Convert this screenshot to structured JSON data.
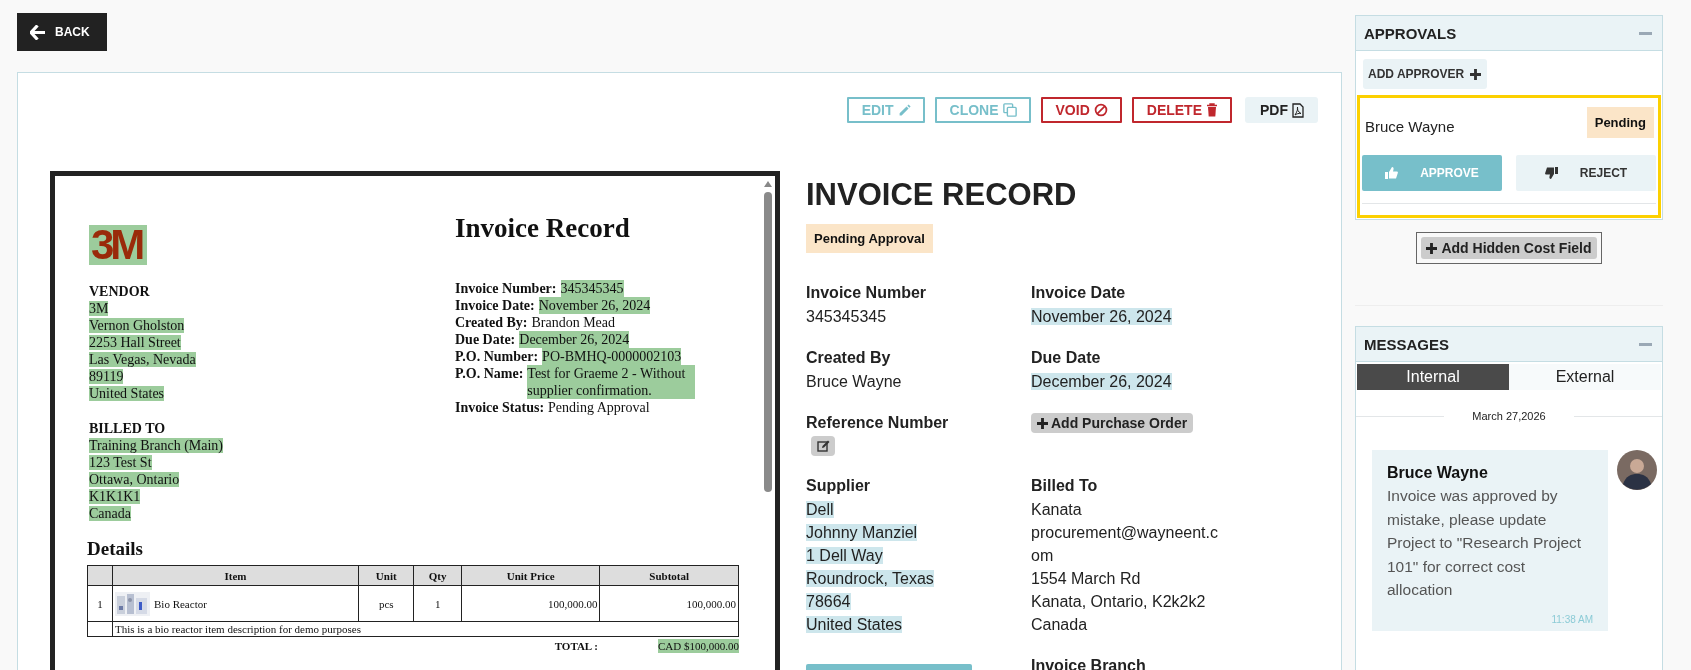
{
  "back_button": "BACK",
  "toolbar": [
    {
      "label": "EDIT",
      "kind": "edit"
    },
    {
      "label": "CLONE",
      "kind": "clone"
    },
    {
      "label": "VOID",
      "kind": "void"
    },
    {
      "label": "DELETE",
      "kind": "delete"
    },
    {
      "label": "PDF",
      "kind": "pdf"
    }
  ],
  "document": {
    "logo": "3M",
    "title": "Invoice Record",
    "vendor": {
      "heading": "VENDOR",
      "lines": [
        {
          "text": "3M",
          "highlighted": true
        },
        {
          "text": "Vernon Gholston",
          "highlighted": true
        },
        {
          "text": "2253 Hall Street",
          "highlighted": true
        },
        {
          "text": "Las Vegas, Nevada",
          "highlighted": true
        },
        {
          "text": "89119",
          "highlighted": true
        },
        {
          "text": "United States",
          "highlighted": true
        }
      ]
    },
    "fields": [
      {
        "label": "Invoice Number:",
        "value": "345345345",
        "highlighted": true
      },
      {
        "label": "Invoice Date:",
        "value": "November 26, 2024",
        "highlighted": true
      },
      {
        "label": "Created By:",
        "value": "Brandon Mead",
        "highlighted": false
      },
      {
        "label": "Due Date:",
        "value": "December 26, 2024",
        "highlighted": true
      },
      {
        "label": "P.O. Number:",
        "value": "PO-BMHQ-0000002103",
        "highlighted": true
      },
      {
        "label": "P.O. Name:",
        "value": "Test for Graeme 2 - Without supplier confirmation.",
        "highlighted": true
      },
      {
        "label": "Invoice Status:",
        "value": "Pending Approval",
        "highlighted": false
      }
    ],
    "billed_to": {
      "heading": "BILLED TO",
      "lines": [
        {
          "text": "Training Branch (Main)",
          "highlighted": true
        },
        {
          "text": "123 Test St",
          "highlighted": true
        },
        {
          "text": "Ottawa, Ontario",
          "highlighted": true
        },
        {
          "text": "K1K1K1",
          "highlighted": true
        },
        {
          "text": "Canada",
          "highlighted": true
        }
      ]
    },
    "details_heading": "Details",
    "table": {
      "columns": [
        "Item",
        "Unit",
        "Qty",
        "Unit Price",
        "Subtotal"
      ],
      "rows": [
        {
          "number": "1",
          "item": "Bio Reactor",
          "unit": "pcs",
          "qty": "1",
          "unit_price": "100,000.00",
          "subtotal": "100,000.00",
          "description": "This is a bio reactor item description for demo purposes"
        }
      ]
    },
    "total": {
      "label": "TOTAL :",
      "value": "CAD $100,000.00",
      "highlighted": true
    }
  },
  "record": {
    "title": "INVOICE RECORD",
    "status": "Pending Approval",
    "items": [
      {
        "kind": "text",
        "label": "Invoice Number",
        "lines": [
          {
            "text": "345345345",
            "highlighted": false
          }
        ]
      },
      {
        "kind": "text",
        "label": "Invoice Date",
        "lines": [
          {
            "text": "November 26, 2024",
            "highlighted": true
          }
        ]
      },
      {
        "kind": "text",
        "label": "Created By",
        "lines": [
          {
            "text": "Bruce Wayne",
            "highlighted": false
          }
        ]
      },
      {
        "kind": "text",
        "label": "Due Date",
        "lines": [
          {
            "text": "December 26, 2024",
            "highlighted": true
          }
        ]
      },
      {
        "kind": "reference",
        "label": "Reference Number"
      },
      {
        "kind": "button",
        "label": "Add Purchase Order"
      },
      {
        "kind": "text",
        "label": "Supplier",
        "lines": [
          {
            "text": "Dell",
            "highlighted": true
          },
          {
            "text": "Johnny Manziel",
            "highlighted": true
          },
          {
            "text": "1 Dell Way",
            "highlighted": true
          },
          {
            "text": "Roundrock, Texas",
            "highlighted": true
          },
          {
            "text": "78664",
            "highlighted": true
          },
          {
            "text": "United States",
            "highlighted": true
          }
        ]
      },
      {
        "kind": "text",
        "label": "Billed To",
        "lines": [
          {
            "text": "Kanata",
            "highlighted": false
          },
          {
            "text": "procurement@wayneent.com",
            "highlighted": false
          },
          {
            "text": "1554 March Rd",
            "highlighted": false
          },
          {
            "text": "Kanata, Ontario, K2k2k2",
            "highlighted": false
          },
          {
            "text": "Canada",
            "highlighted": false
          }
        ]
      },
      {
        "kind": "files_button"
      },
      {
        "kind": "text",
        "label": "Invoice Branch"
      }
    ]
  },
  "approvals": {
    "title": "APPROVALS",
    "add_button": "ADD APPROVER",
    "approvers": [
      {
        "name": "Bruce Wayne",
        "status": "Pending",
        "selected": true,
        "actions": [
          {
            "label": "APPROVE",
            "kind": "approve"
          },
          {
            "label": "REJECT",
            "kind": "reject"
          }
        ]
      }
    ]
  },
  "hidden_cost_button": "Add Hidden Cost Field",
  "messages": {
    "title": "MESSAGES",
    "tabs": [
      {
        "label": "Internal",
        "selected": true
      },
      {
        "label": "External",
        "selected": false
      }
    ],
    "date": "March 27,2026",
    "items": [
      {
        "author": "Bruce Wayne",
        "text": "Invoice was approved by mistake, please update Project to \"Research Project 101\" for correct cost allocation",
        "time": "11:38 AM"
      }
    ]
  }
}
